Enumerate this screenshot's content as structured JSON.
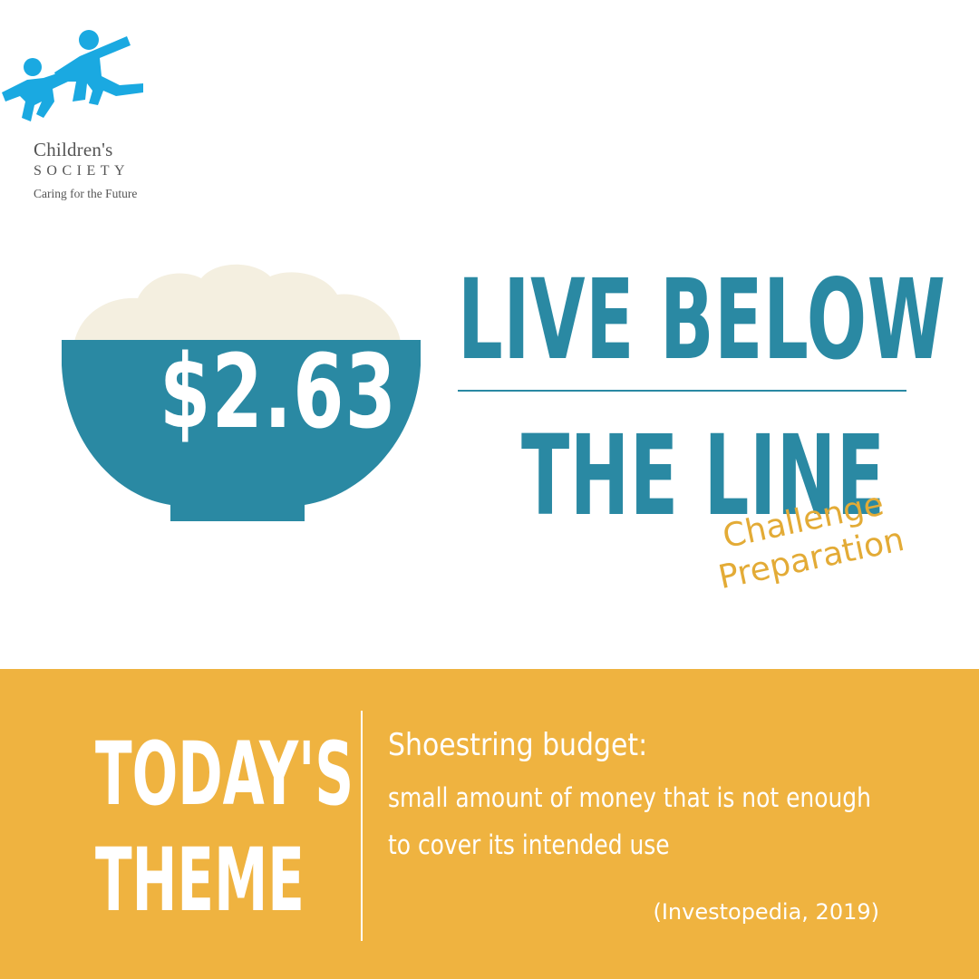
{
  "logo": {
    "name": "Children's",
    "society": "SOCIETY",
    "tagline": "Caring for the Future"
  },
  "bowl": {
    "price": "$2.63"
  },
  "headline": {
    "line1": "LIVE BELOW",
    "line2": "THE LINE"
  },
  "subtag": {
    "line1": "Challenge",
    "line2": "Preparation"
  },
  "theme": {
    "label_line1": "TODAY'S",
    "label_line2": "THEME",
    "term": "Shoestring budget:",
    "definition": "small amount of money that is not enough to cover its intended use",
    "citation": "(Investopedia, 2019)"
  },
  "colors": {
    "teal": "#2a89a3",
    "mustard": "#efb340",
    "rice": "#f4efe0",
    "logo_blue": "#1aa9e1"
  },
  "icons": {
    "logo": "children-holding-hands-icon",
    "bowl": "rice-bowl-icon"
  }
}
